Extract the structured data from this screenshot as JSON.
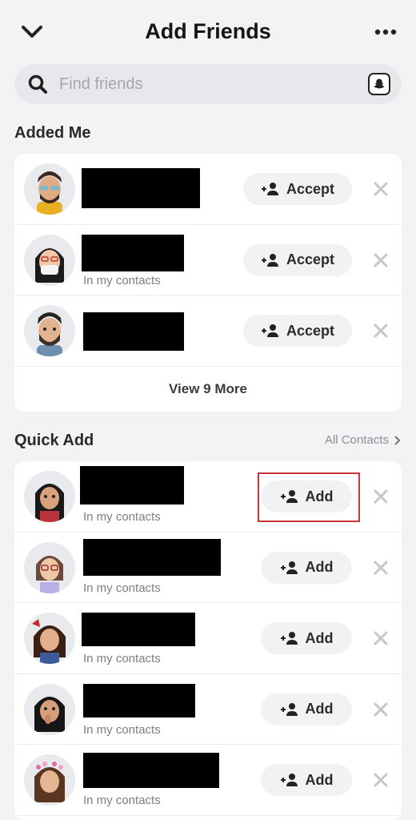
{
  "header": {
    "title": "Add Friends",
    "back_icon": "chevron-down-icon",
    "more_icon": "ellipsis-icon"
  },
  "search": {
    "placeholder": "Find friends"
  },
  "added_me": {
    "title": "Added Me",
    "accept_label": "Accept",
    "rows": [
      {
        "subtitle": ""
      },
      {
        "subtitle": "In my contacts"
      },
      {
        "subtitle": ""
      }
    ],
    "view_more": "View 9 More"
  },
  "quick_add": {
    "title": "Quick Add",
    "all_contacts": "All Contacts",
    "add_label": "Add",
    "rows": [
      {
        "subtitle": "In my contacts"
      },
      {
        "subtitle": "In my contacts"
      },
      {
        "subtitle": "In my contacts"
      },
      {
        "subtitle": "In my contacts"
      },
      {
        "subtitle": "In my contacts"
      }
    ]
  },
  "colors": {
    "background": "#f2f3f5",
    "card": "#ffffff",
    "pill": "#f1f2f4",
    "highlight": "#c8353a"
  }
}
